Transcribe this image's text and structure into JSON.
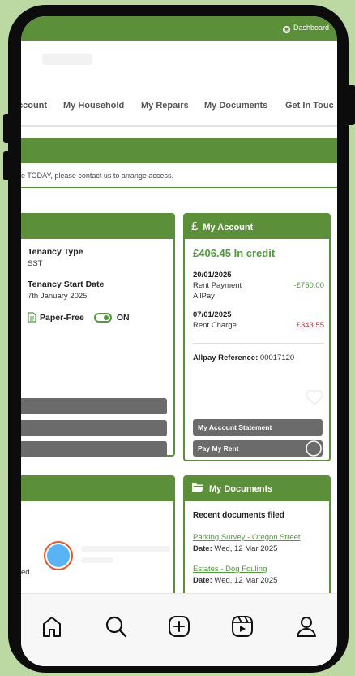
{
  "topbar": {
    "dashboard_label": "Dashboard"
  },
  "nav": {
    "items": [
      {
        "label": "ccount"
      },
      {
        "label": "My Household"
      },
      {
        "label": "My Repairs"
      },
      {
        "label": "My Documents"
      },
      {
        "label": "Get In Touc"
      }
    ]
  },
  "notice": {
    "text": "e TODAY, please contact us to arrange access."
  },
  "tenancy": {
    "type_label": "Tenancy Type",
    "type_value": "SST",
    "start_label": "Tenancy Start Date",
    "start_value": "7th January 2025",
    "paperfree_label": "Paper-Free",
    "paperfree_state": "ON"
  },
  "account": {
    "header": "My Account",
    "currency_symbol": "£",
    "balance": "£406.45 In credit",
    "transactions": [
      {
        "date": "20/01/2025",
        "desc": "Rent Payment",
        "sub": "AllPay",
        "amount": "-£750.00"
      },
      {
        "date": "07/01/2025",
        "desc": "Rent Charge",
        "sub": "",
        "amount": "£343.55"
      }
    ],
    "reference_label": "Allpay Reference:",
    "reference_value": "00017120",
    "statement_button": "My Account Statement",
    "pay_button": "Pay My Rent"
  },
  "household": {
    "partial_text": "ed"
  },
  "documents": {
    "header": "My Documents",
    "subtitle": "Recent documents filed",
    "items": [
      {
        "title": "Parking Survey - Oregon Street",
        "date_label": "Date:",
        "date": "Wed, 12 Mar 2025"
      },
      {
        "title": "Estates - Dog Fouling",
        "date_label": "Date:",
        "date": "Wed, 12 Mar 2025"
      }
    ]
  },
  "colors": {
    "brand_green": "#5c8f3a",
    "credit_green": "#4f9a3b",
    "debit_red": "#c8243c",
    "button_gray": "#6b6b6b"
  }
}
